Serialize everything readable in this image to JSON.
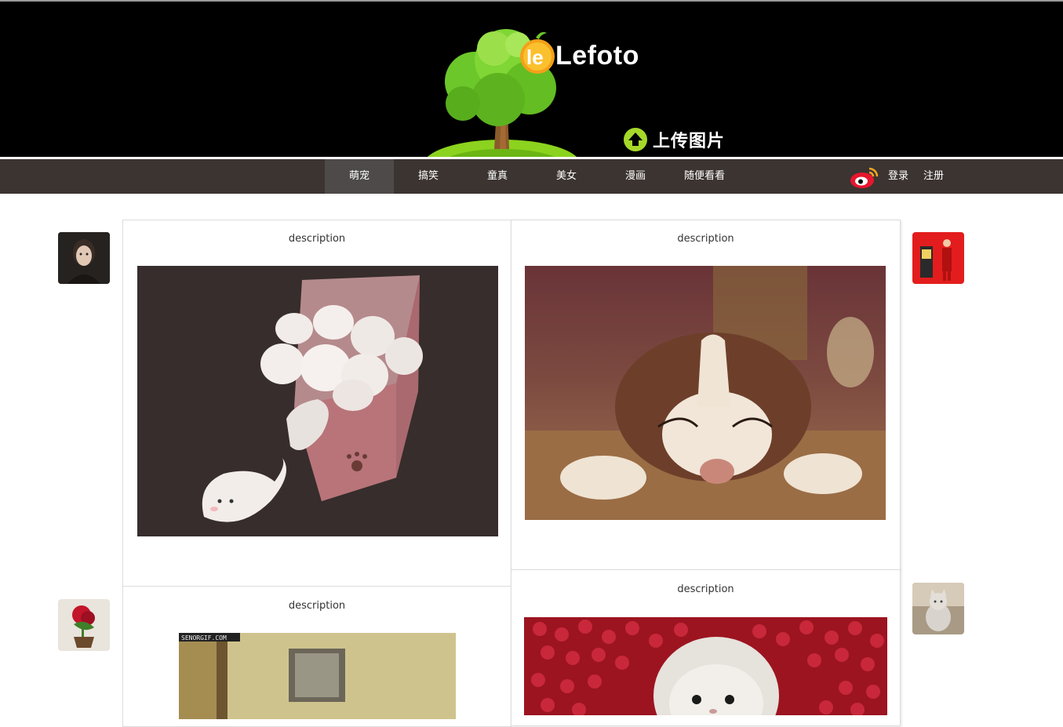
{
  "header": {
    "brand": "Lefoto",
    "logo_badge": "le",
    "upload_label": "上传图片"
  },
  "nav": {
    "items": [
      {
        "label": "萌宠",
        "active": true
      },
      {
        "label": "搞笑",
        "active": false
      },
      {
        "label": "童真",
        "active": false
      },
      {
        "label": "美女",
        "active": false
      },
      {
        "label": "漫画",
        "active": false
      },
      {
        "label": "随便看看",
        "active": false
      }
    ],
    "login": "登录",
    "register": "注册"
  },
  "cards": [
    {
      "description": "description",
      "image": "white kittens in a pink box (illustration)"
    },
    {
      "description": "description",
      "image": "sleeping husky puppy"
    },
    {
      "description": "description",
      "image": "cat at a pet door (gif)",
      "watermark": "SENORGIF.COM"
    },
    {
      "description": "description",
      "image": "hamster on red berries"
    }
  ],
  "side_thumbs": {
    "left": [
      "girl portrait",
      "red flower pot"
    ],
    "right": [
      "red comic panel",
      "cat sculpture"
    ]
  },
  "colors": {
    "header_bg": "#000000",
    "nav_bg": "#3c3431",
    "nav_active_bg": "#4d4a49",
    "logo_green": "#7ccc1c",
    "upload_green": "#a6d82a"
  }
}
